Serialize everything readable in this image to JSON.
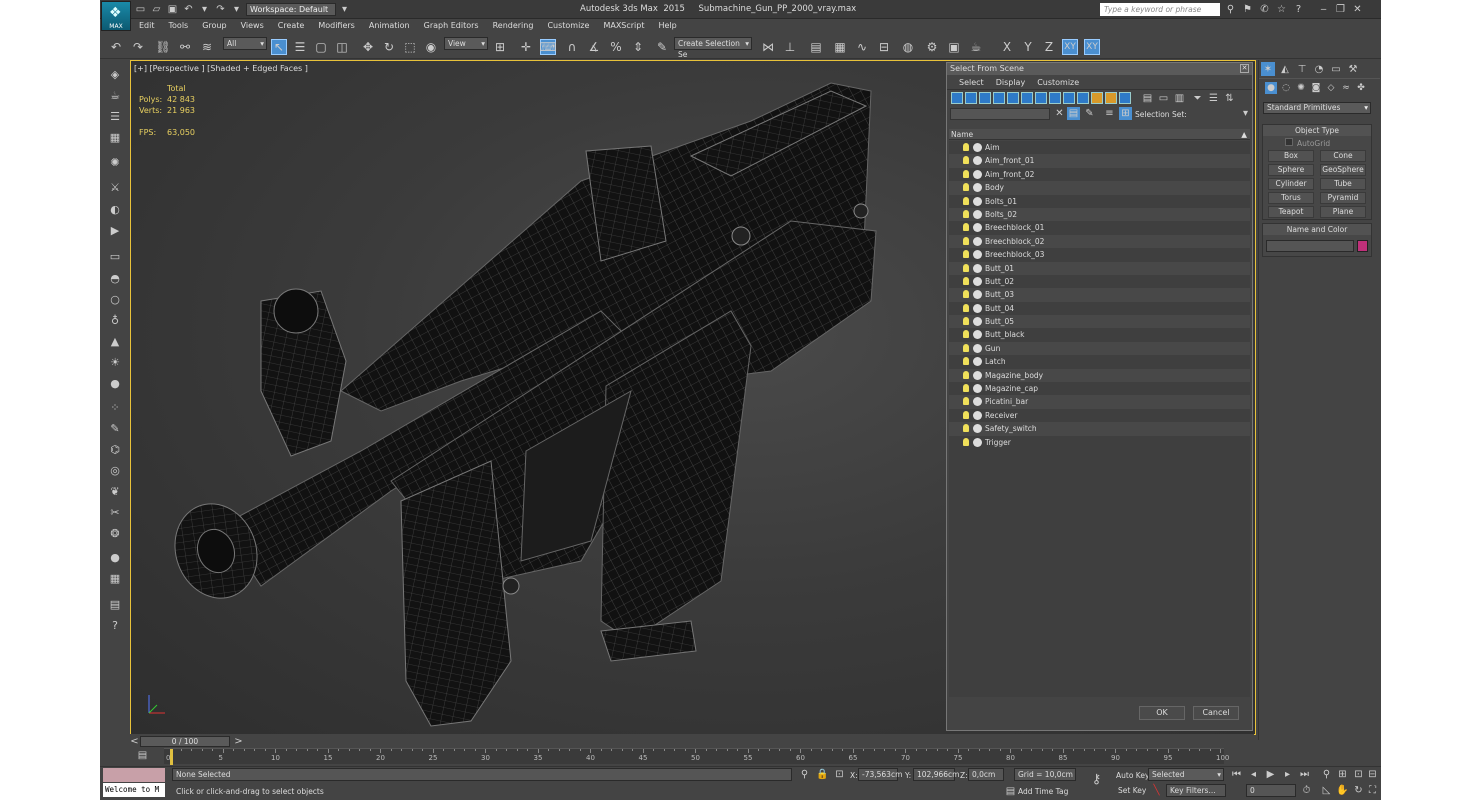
{
  "titlebar": {
    "logo_label": "MAX",
    "workspace": "Workspace: Default",
    "app_title": "Autodesk 3ds Max  2015     Submachine_Gun_PP_2000_vray.max",
    "search_placeholder": "Type a keyword or phrase"
  },
  "menu": [
    "Edit",
    "Tools",
    "Group",
    "Views",
    "Create",
    "Modifiers",
    "Animation",
    "Graph Editors",
    "Rendering",
    "Customize",
    "MAXScript",
    "Help"
  ],
  "toolbar": {
    "filter": "All",
    "refcoord": "View",
    "selection_set": "Create Selection Se",
    "axis": [
      "X",
      "Y",
      "Z",
      "XY",
      "XY"
    ]
  },
  "viewport": {
    "label": "[+] [Perspective ] [Shaded + Edged Faces ]",
    "stats": {
      "header": "Total",
      "polys_label": "Polys:",
      "polys": "42 843",
      "verts_label": "Verts:",
      "verts": "21 963",
      "fps_label": "FPS:",
      "fps": "63,050"
    }
  },
  "scene_explorer": {
    "title": "Select From Scene",
    "menu": [
      "Select",
      "Display",
      "Customize"
    ],
    "selection_set_label": "Selection Set:",
    "column": "Name",
    "items": [
      "Aim",
      "Aim_front_01",
      "Aim_front_02",
      "Body",
      "Bolts_01",
      "Bolts_02",
      "Breechblock_01",
      "Breechblock_02",
      "Breechblock_03",
      "Butt_01",
      "Butt_02",
      "Butt_03",
      "Butt_04",
      "Butt_05",
      "Butt_black",
      "Gun",
      "Latch",
      "Magazine_body",
      "Magazine_cap",
      "Picatini_bar",
      "Receiver",
      "Safety_switch",
      "Trigger"
    ],
    "ok": "OK",
    "cancel": "Cancel"
  },
  "command_panel": {
    "category": "Standard Primitives",
    "object_type": "Object Type",
    "autogrid": "AutoGrid",
    "buttons": [
      "Box",
      "Cone",
      "Sphere",
      "GeoSphere",
      "Cylinder",
      "Tube",
      "Torus",
      "Pyramid",
      "Teapot",
      "Plane"
    ],
    "name_and_color": "Name and Color",
    "swatch_color": "#c0307a"
  },
  "timeline": {
    "slider": "0 / 100",
    "ticks": [
      "0",
      "5",
      "10",
      "15",
      "20",
      "25",
      "30",
      "35",
      "40",
      "45",
      "50",
      "55",
      "60",
      "65",
      "70",
      "75",
      "80",
      "85",
      "90",
      "95",
      "100"
    ]
  },
  "status": {
    "welcome": "Welcome to M",
    "selected": "None Selected",
    "prompt": "Click or click-and-drag to select objects",
    "x_label": "X:",
    "x": "-73,563cm",
    "y_label": "Y:",
    "y": "102,966cm",
    "z_label": "Z:",
    "z": "0,0cm",
    "grid": "Grid = 10,0cm",
    "add_time_tag": "Add Time Tag",
    "auto_key": "Auto Key",
    "set_key": "Set Key",
    "key_mode": "Selected",
    "key_filters": "Key Filters...",
    "frame": "0"
  }
}
